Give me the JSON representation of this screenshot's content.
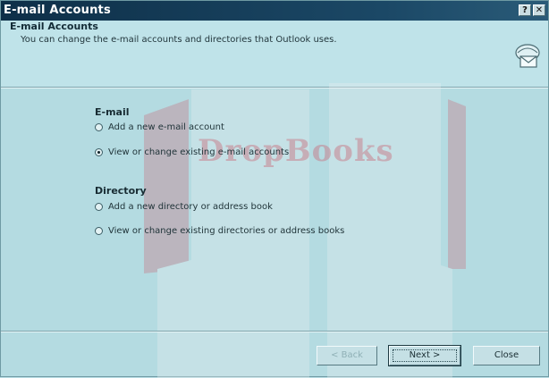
{
  "window": {
    "title": "E-mail Accounts",
    "help_glyph": "?",
    "close_glyph": "✕"
  },
  "header": {
    "title": "E-mail Accounts",
    "subtitle": "You can change the e-mail accounts and directories that Outlook uses.",
    "icon": "mailbox-envelope-icon"
  },
  "email_group": {
    "heading": "E-mail",
    "options": [
      {
        "label": "Add a new e-mail account",
        "selected": false
      },
      {
        "label": "View or change existing e-mail accounts",
        "selected": true
      }
    ]
  },
  "directory_group": {
    "heading": "Directory",
    "options": [
      {
        "label": "Add a new directory or address book",
        "selected": false
      },
      {
        "label": "View or change existing directories or address books",
        "selected": false
      }
    ]
  },
  "buttons": {
    "back": "< Back",
    "next": "Next >",
    "close": "Close"
  },
  "watermark": {
    "text": "DropBooks"
  },
  "colors": {
    "titlebar": "#0e2f48",
    "dialog_bg": "#b4dbe1",
    "watermark": "#c8707e"
  }
}
